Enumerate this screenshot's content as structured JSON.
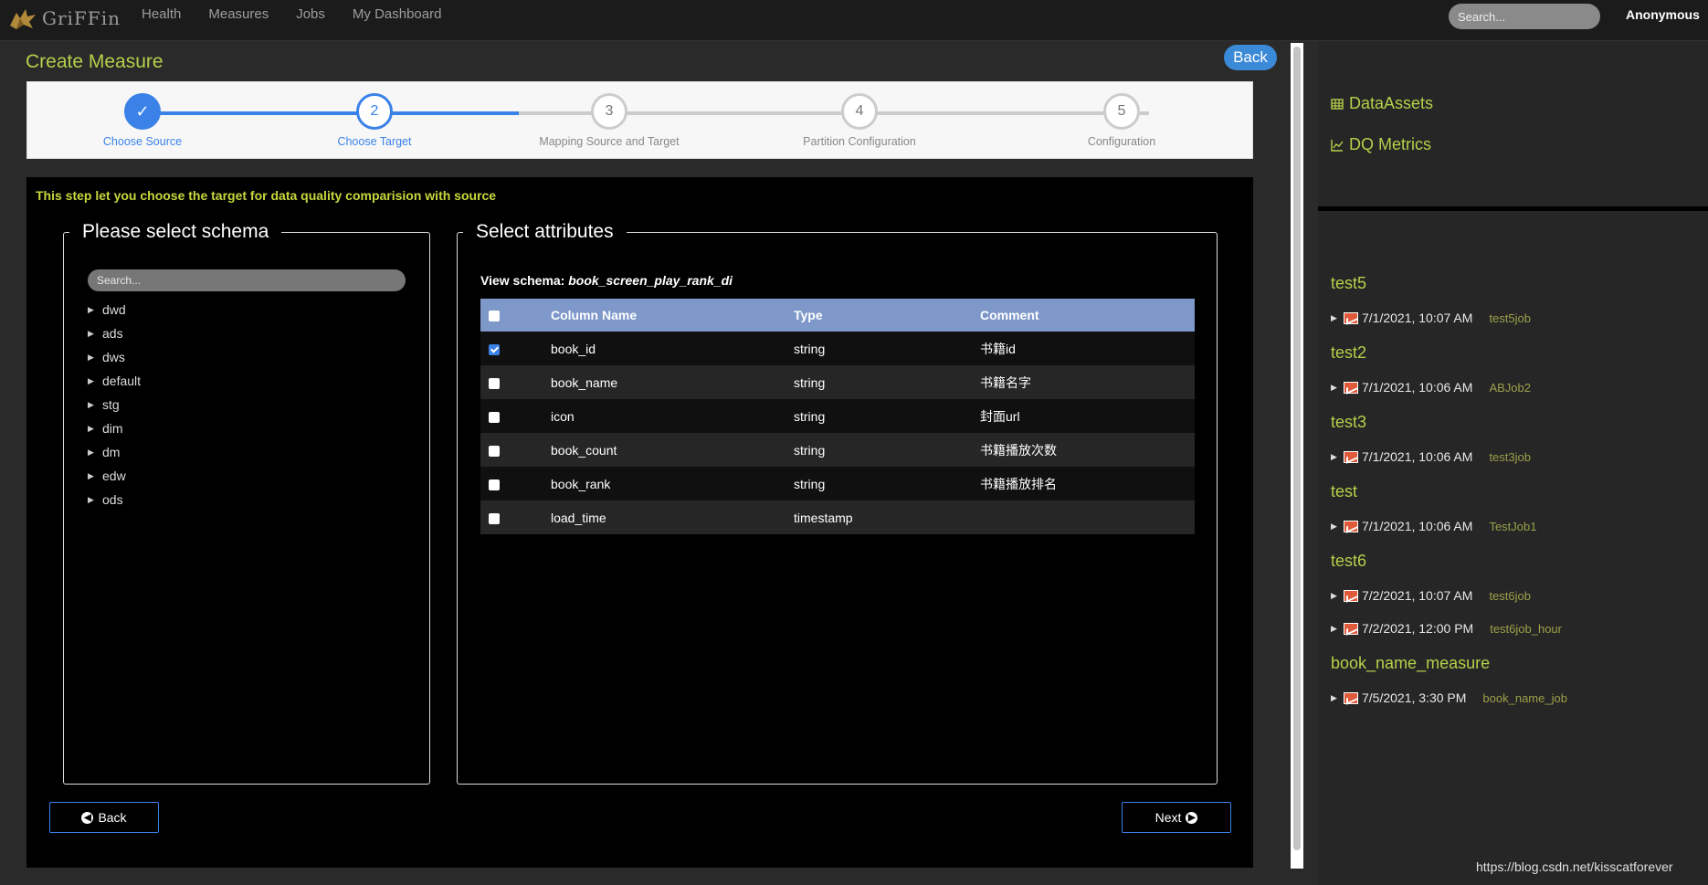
{
  "app": {
    "logo": "GriFFin"
  },
  "nav": {
    "items": [
      "Health",
      "Measures",
      "Jobs",
      "My Dashboard"
    ]
  },
  "top_search": {
    "placeholder": "Search..."
  },
  "user": "Anonymous",
  "page": {
    "title": "Create Measure",
    "back_label": "Back"
  },
  "steps": [
    {
      "num": "✓",
      "label": "Choose Source",
      "state": "complete"
    },
    {
      "num": "2",
      "label": "Choose Target",
      "state": "active"
    },
    {
      "num": "3",
      "label": "Mapping Source and Target",
      "state": "todo"
    },
    {
      "num": "4",
      "label": "Partition Configuration",
      "state": "todo"
    },
    {
      "num": "5",
      "label": "Configuration",
      "state": "todo"
    }
  ],
  "hint": "This step let you choose the target for data quality comparision with source",
  "schema": {
    "legend": "Please select schema",
    "search_placeholder": "Search...",
    "items": [
      "dwd",
      "ads",
      "dws",
      "default",
      "stg",
      "dim",
      "dm",
      "edw",
      "ods"
    ]
  },
  "attributes": {
    "legend": "Select attributes",
    "view_label": "View schema:",
    "view_name": "book_screen_play_rank_di",
    "headers": [
      "Column Name",
      "Type",
      "Comment"
    ],
    "rows": [
      {
        "name": "book_id",
        "type": "string",
        "comment": "书籍id",
        "checked": true
      },
      {
        "name": "book_name",
        "type": "string",
        "comment": "书籍名字",
        "checked": false
      },
      {
        "name": "icon",
        "type": "string",
        "comment": "封面url",
        "checked": false
      },
      {
        "name": "book_count",
        "type": "string",
        "comment": "书籍播放次数",
        "checked": false
      },
      {
        "name": "book_rank",
        "type": "string",
        "comment": "书籍播放排名",
        "checked": false
      },
      {
        "name": "load_time",
        "type": "timestamp",
        "comment": "",
        "checked": false
      }
    ]
  },
  "buttons": {
    "back": "Back",
    "next": "Next"
  },
  "sidebar": {
    "links": [
      "DataAssets",
      "DQ Metrics"
    ],
    "groups": [
      {
        "title": "test5",
        "jobs": [
          {
            "date": "7/1/2021, 10:07 AM",
            "job": "test5job"
          }
        ]
      },
      {
        "title": "test2",
        "jobs": [
          {
            "date": "7/1/2021, 10:06 AM",
            "job": "ABJob2"
          }
        ]
      },
      {
        "title": "test3",
        "jobs": [
          {
            "date": "7/1/2021, 10:06 AM",
            "job": "test3job"
          }
        ]
      },
      {
        "title": "test",
        "jobs": [
          {
            "date": "7/1/2021, 10:06 AM",
            "job": "TestJob1"
          }
        ]
      },
      {
        "title": "test6",
        "jobs": [
          {
            "date": "7/2/2021, 10:07 AM",
            "job": "test6job"
          },
          {
            "date": "7/2/2021, 12:00 PM",
            "job": "test6job_hour"
          }
        ]
      },
      {
        "title": "book_name_measure",
        "jobs": [
          {
            "date": "7/5/2021, 3:30 PM",
            "job": "book_name_job"
          }
        ]
      }
    ]
  },
  "watermark": "https://blog.csdn.net/kisscatforever"
}
